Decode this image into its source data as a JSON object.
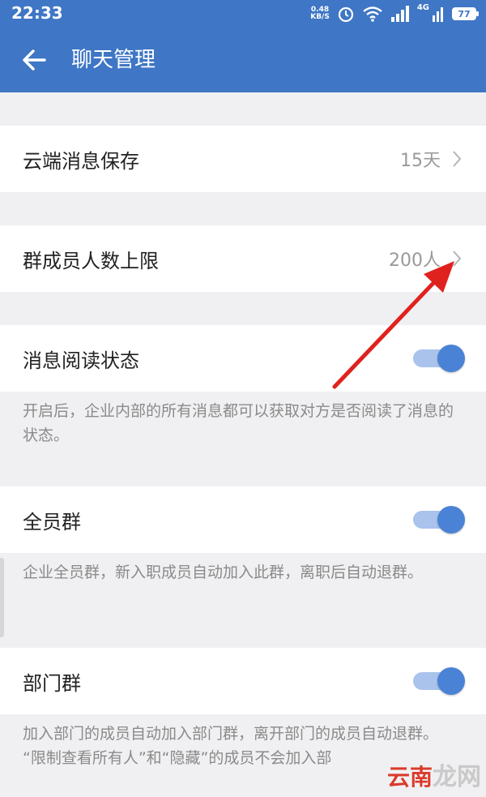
{
  "statusbar": {
    "time": "22:33",
    "net_speed_value": "0.48",
    "net_speed_unit": "KB/S",
    "network_label": "4G",
    "battery_level": "77",
    "icons": [
      "alarm-icon",
      "wifi-icon",
      "signal-icon",
      "battery-icon"
    ]
  },
  "appbar": {
    "title": "聊天管理",
    "back_icon": "arrow-left-icon"
  },
  "settings": {
    "cloud_storage": {
      "label": "云端消息保存",
      "value": "15天"
    },
    "member_limit": {
      "label": "群成员人数上限",
      "value": "200人"
    },
    "read_status": {
      "label": "消息阅读状态",
      "enabled": true,
      "description": "开启后，企业内部的所有消息都可以获取对方是否阅读了消息的状态。"
    },
    "all_staff_group": {
      "label": "全员群",
      "enabled": true,
      "description": "企业全员群，新入职成员自动加入此群，离职后自动退群。"
    },
    "department_group": {
      "label": "部门群",
      "enabled": true,
      "description_line1": "加入部门的成员自动加入部门群，离开部门的成员自动退群。",
      "description_line2": "“限制查看所有人”和“隐藏”的成员不会加入部"
    }
  },
  "watermark": {
    "part1": "云南",
    "part2": "龙网"
  },
  "colors": {
    "primary": "#3f76c5",
    "toggle_knob": "#4a83d6",
    "toggle_track": "#a9c3ec",
    "annotation_arrow": "#e0221f",
    "background": "#f0f0f2"
  }
}
